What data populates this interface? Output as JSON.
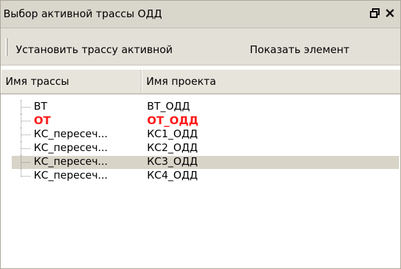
{
  "window": {
    "title": "Выбор активной трассы ОДД",
    "pin_icon": "restore-dock-icon",
    "close_icon": "close-icon"
  },
  "toolbar": {
    "set_active_label": "Установить трассу активной",
    "show_element_label": "Показать элемент"
  },
  "table": {
    "columns": [
      "Имя трассы",
      "Имя проекта"
    ],
    "rows": [
      {
        "route": "ВТ",
        "project": "ВТ_ОДД",
        "active": false,
        "selected": false
      },
      {
        "route": "ОТ",
        "project": "ОТ_ОДД",
        "active": true,
        "selected": false
      },
      {
        "route": "КС_пересеч...",
        "project": "КС1_ОДД",
        "active": false,
        "selected": false
      },
      {
        "route": "КС_пересеч...",
        "project": "КС2_ОДД",
        "active": false,
        "selected": false
      },
      {
        "route": "КС_пересеч...",
        "project": "КС3_ОДД",
        "active": false,
        "selected": true
      },
      {
        "route": "КС_пересеч...",
        "project": "КС4_ОДД",
        "active": false,
        "selected": false
      }
    ]
  },
  "colors": {
    "active_row": "#ff1a1a",
    "selected_row_bg": "#d9d4c8",
    "titlebar_bg": "#d9d6cc"
  }
}
